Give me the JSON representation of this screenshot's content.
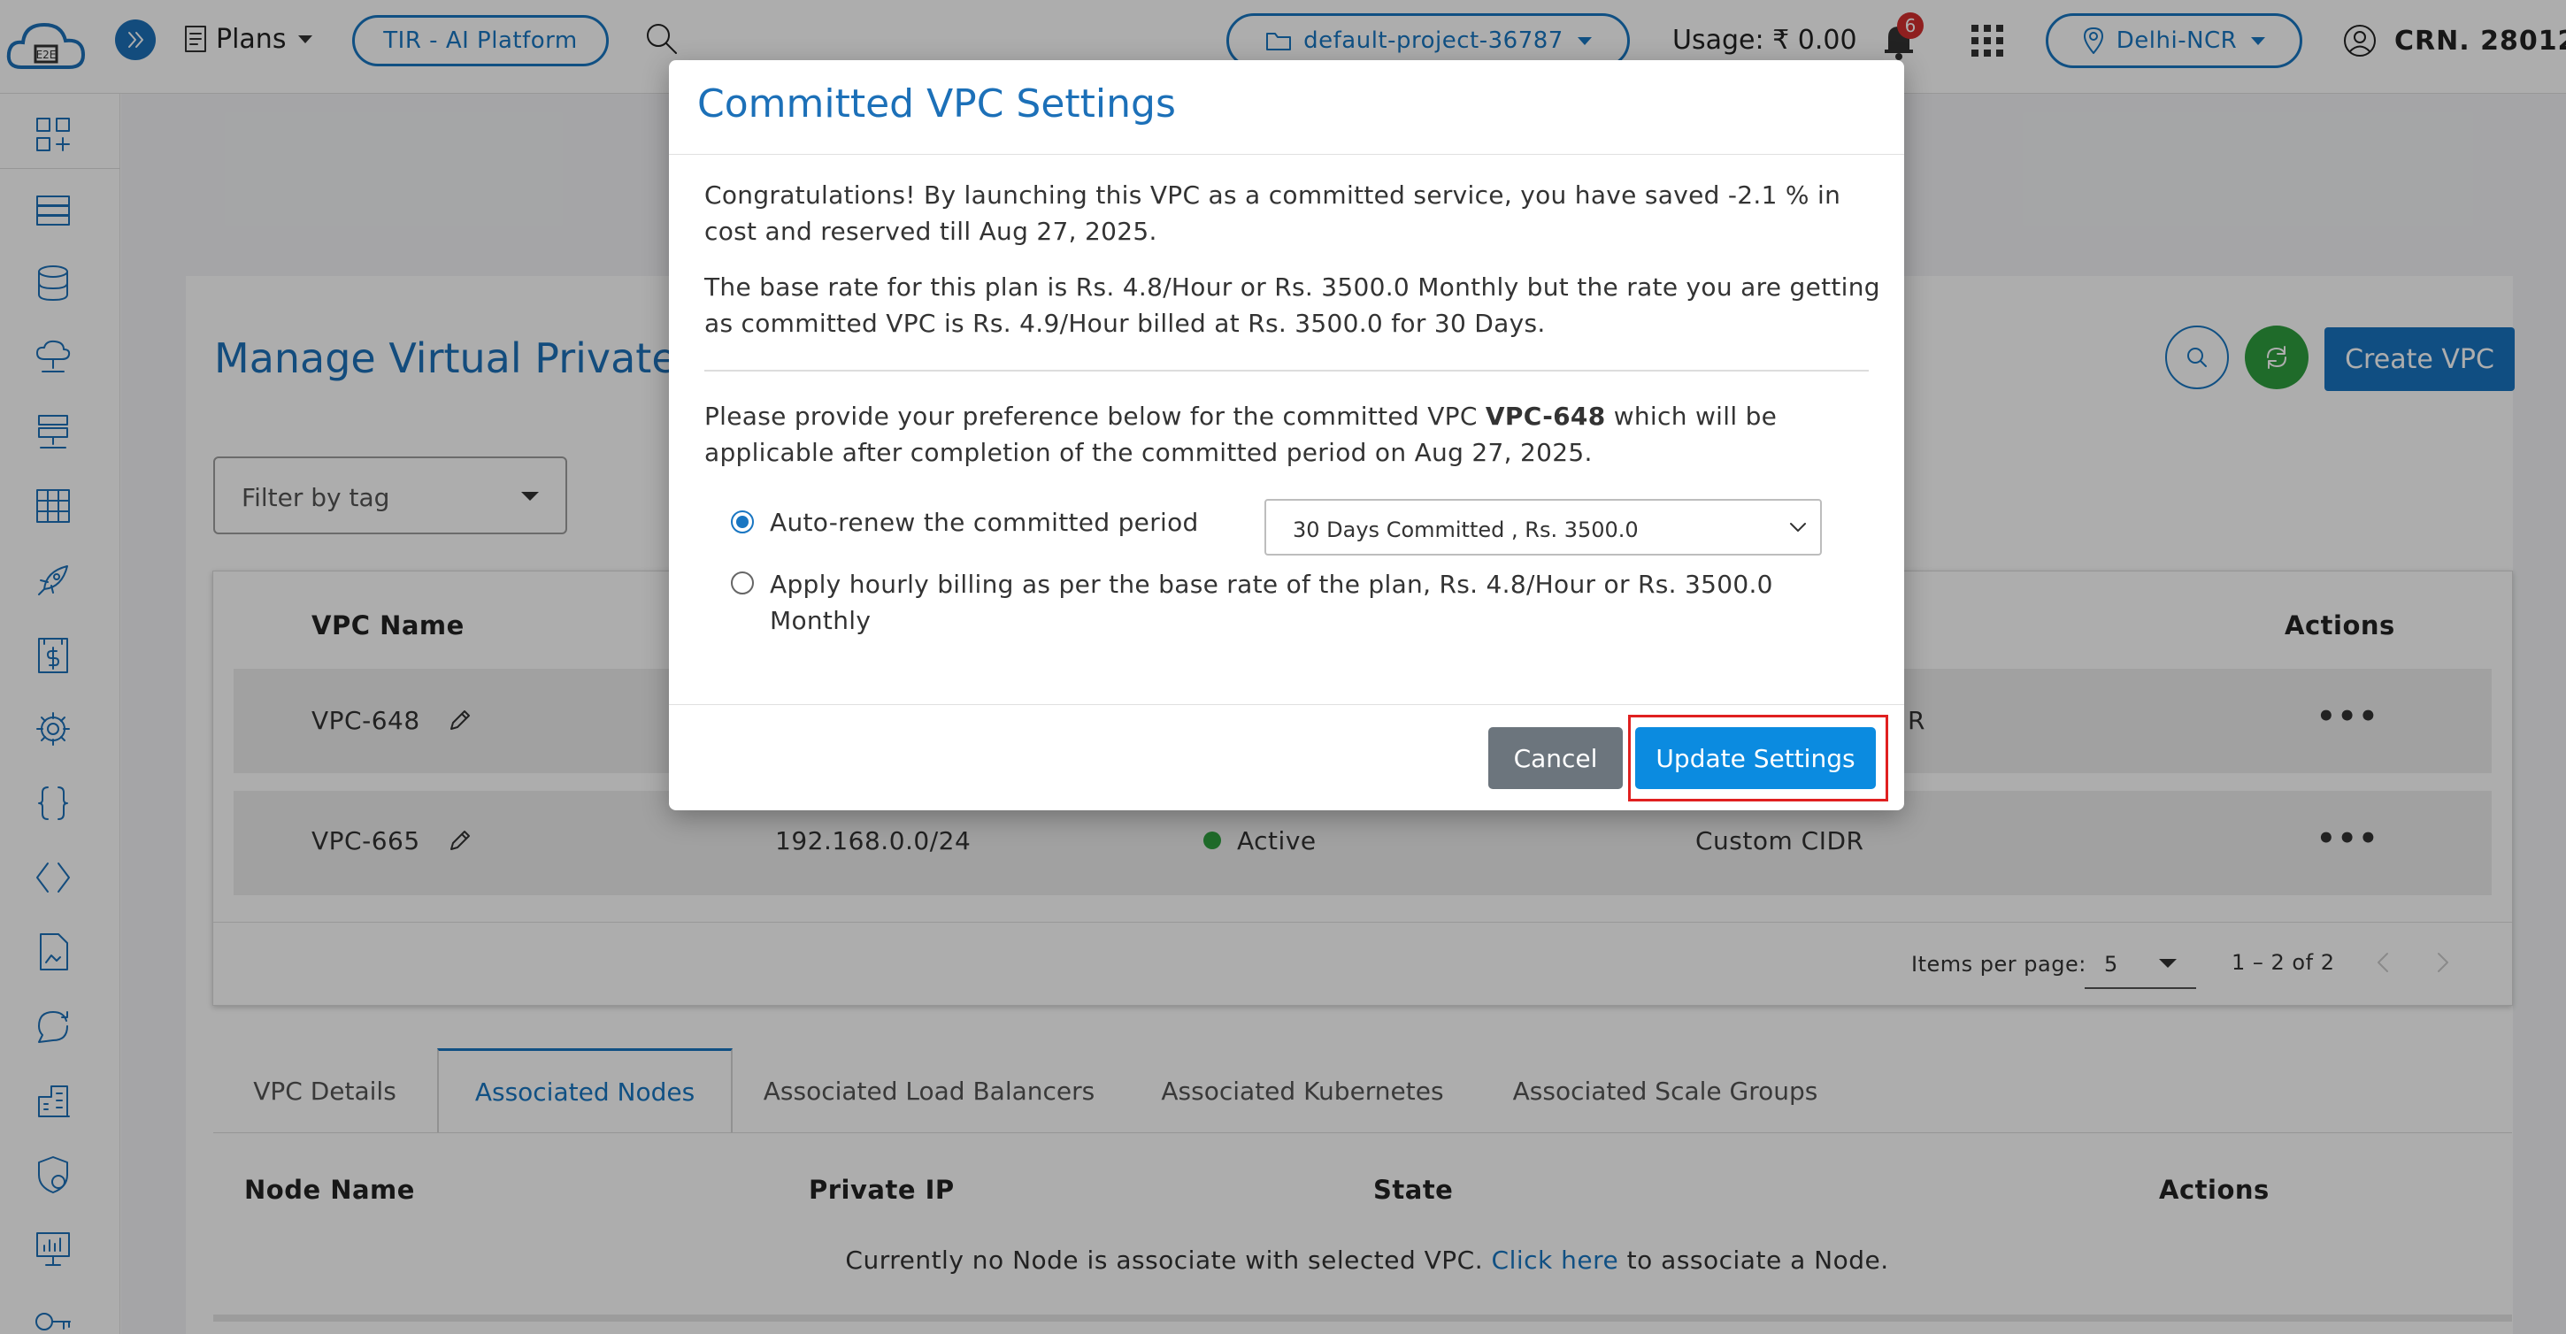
{
  "topbar": {
    "plans_label": "Plans",
    "tir_label": "TIR - AI Platform",
    "project_label": "default-project-36787",
    "usage_label": "Usage: ₹ 0.00",
    "notification_count": "6",
    "region_label": "Delhi-NCR",
    "crn_label": "CRN. 28012"
  },
  "page": {
    "title": "Manage Virtual Private",
    "filter_placeholder": "Filter by tag",
    "create_button": "Create VPC"
  },
  "table": {
    "headers": {
      "vpc_name": "VPC Name",
      "actions": "Actions"
    },
    "rows": [
      {
        "name": "VPC-648",
        "cidr": "",
        "state": "",
        "cidr_type": "R"
      },
      {
        "name": "VPC-665",
        "cidr": "192.168.0.0/24",
        "state": "Active",
        "cidr_type": "Custom CIDR"
      }
    ],
    "status_color": "#2e9e3f",
    "pagination": {
      "items_per_page_label": "Items per page:",
      "items_per_page": "5",
      "range": "1 – 2 of 2"
    }
  },
  "tabs": [
    "VPC Details",
    "Associated Nodes",
    "Associated Load Balancers",
    "Associated Kubernetes",
    "Associated Scale Groups"
  ],
  "nodes_table": {
    "headers": [
      "Node Name",
      "Private IP",
      "State",
      "Actions"
    ],
    "empty_prefix": "Currently no Node is associate with selected VPC.",
    "empty_link": "Click here",
    "empty_suffix": "to associate a Node."
  },
  "modal": {
    "title": "Committed VPC Settings",
    "congrats": "Congratulations! By launching this VPC as a committed service, you have saved -2.1 % in cost and reserved till Aug 27, 2025.",
    "base_rate": "The base rate for this plan is Rs. 4.8/Hour or Rs. 3500.0 Monthly but the rate you are getting as committed VPC is Rs. 4.9/Hour billed at Rs. 3500.0 for 30 Days.",
    "pref_prefix": "Please provide your preference below for the committed VPC",
    "pref_vpc": "VPC-648",
    "pref_suffix": "which will be applicable after completion of the committed period on Aug 27, 2025.",
    "option_auto": "Auto-renew the committed period",
    "option_hourly_line1": "Apply hourly billing as per the base rate of the plan, Rs. 4.8/Hour or Rs. 3500.0",
    "option_hourly_line2": "Monthly",
    "select_value": "30 Days Committed , Rs. 3500.0",
    "cancel": "Cancel",
    "update": "Update Settings"
  }
}
